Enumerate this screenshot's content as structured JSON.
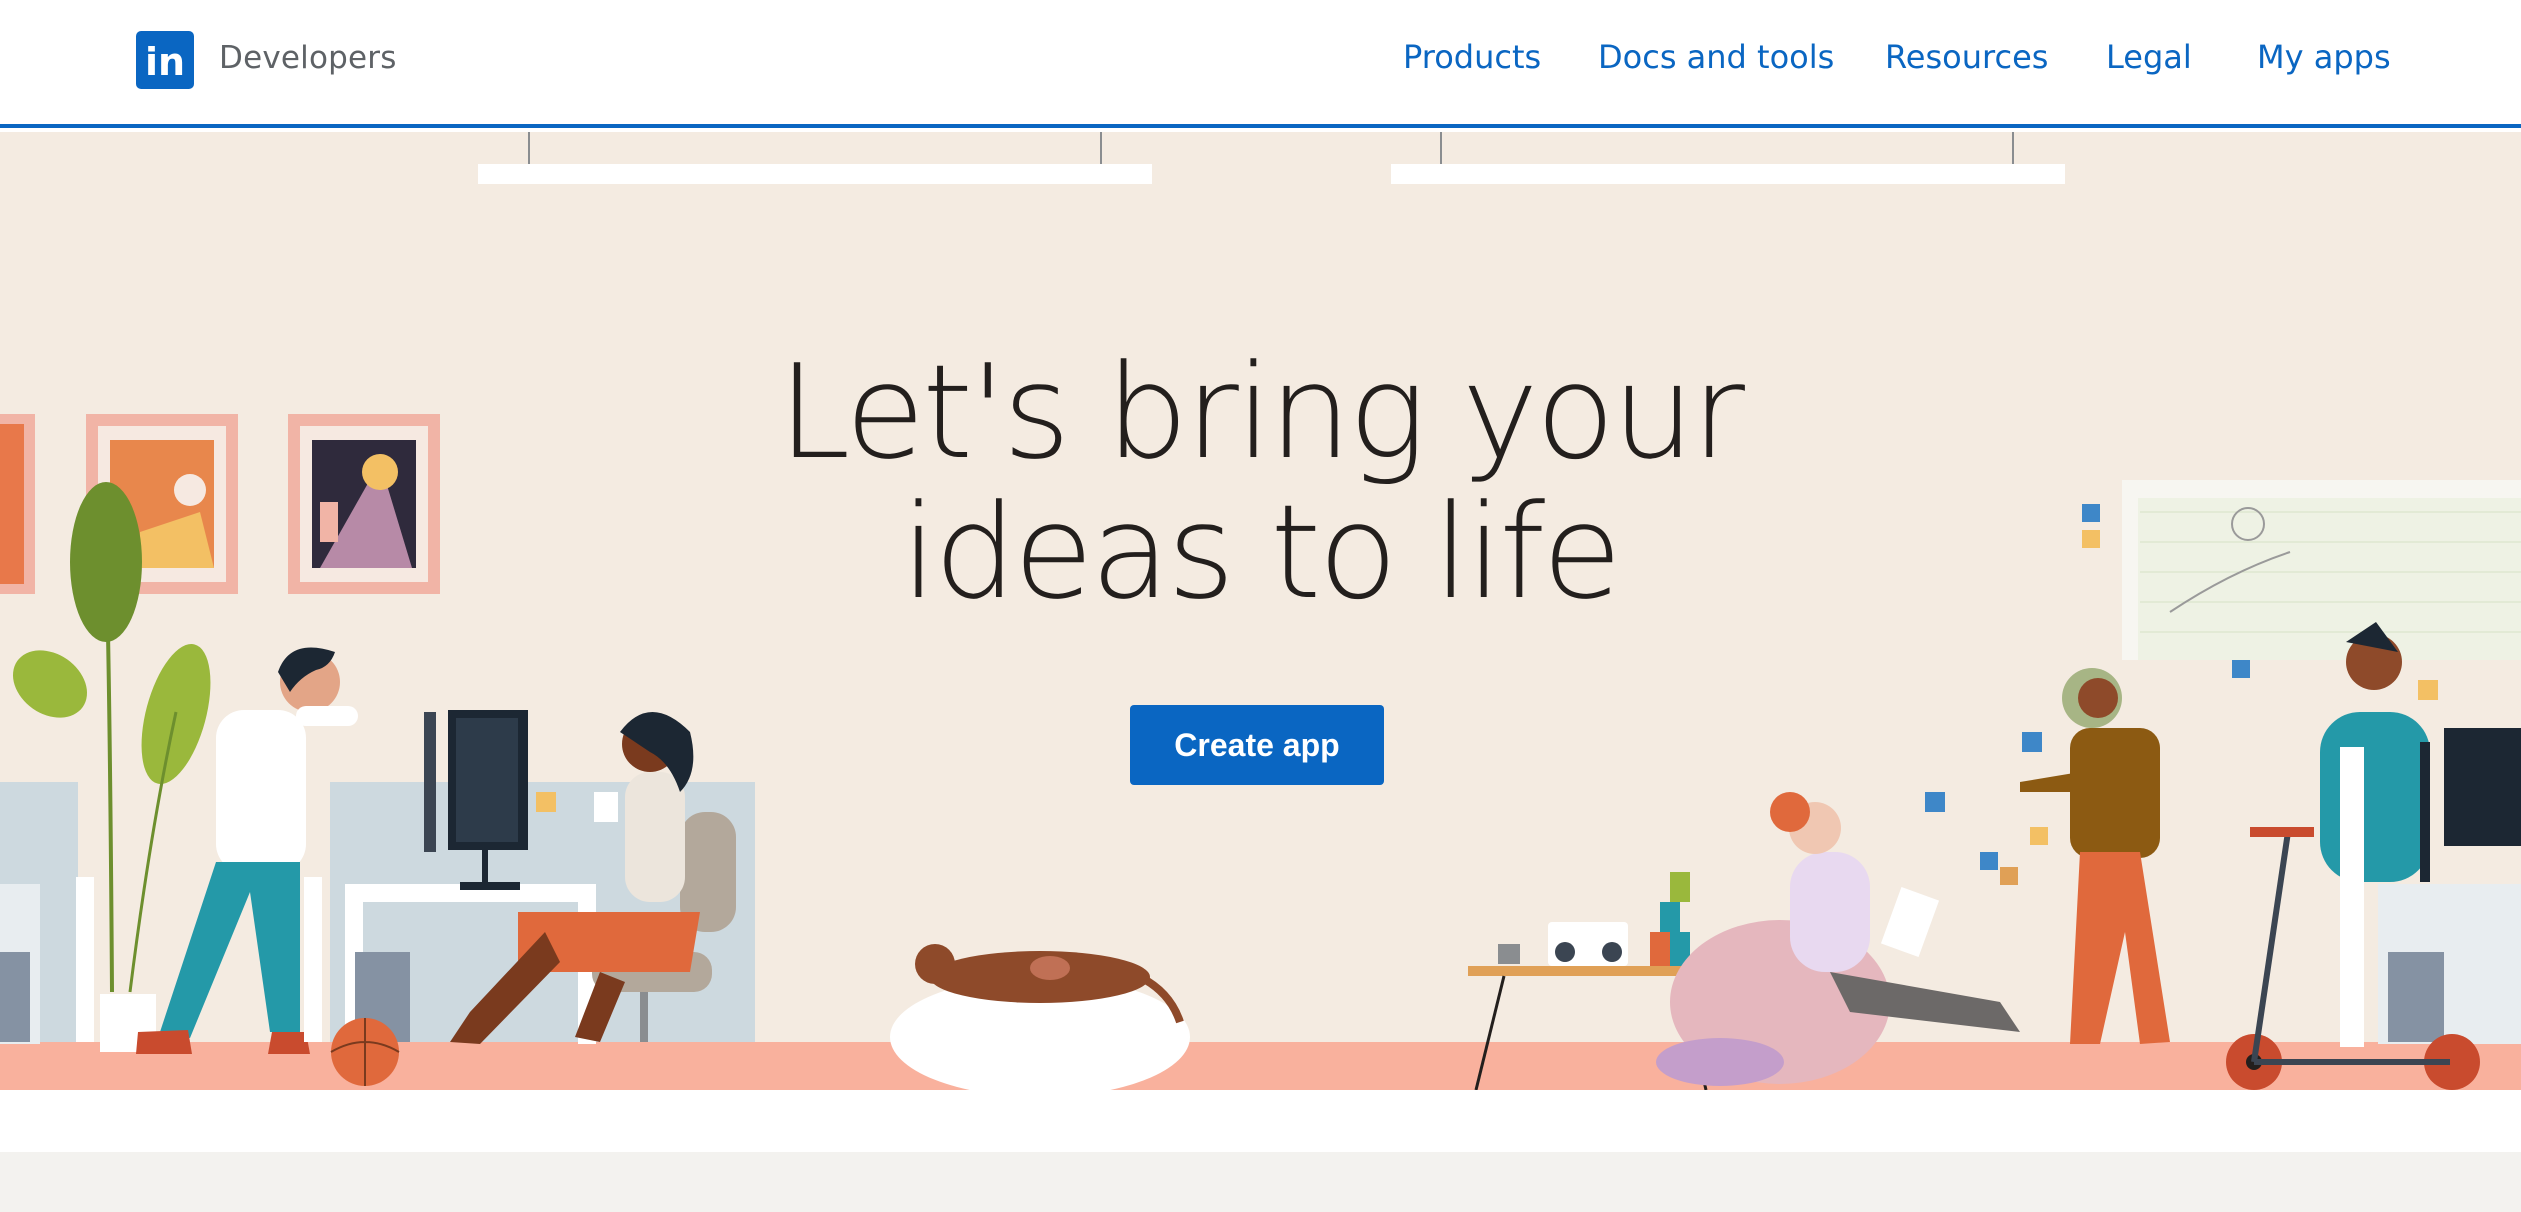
{
  "header": {
    "logo_text": "in",
    "brand": "Developers",
    "nav": [
      {
        "label": "Products",
        "name": "nav-products"
      },
      {
        "label": "Docs and tools",
        "name": "nav-docs-and-tools"
      },
      {
        "label": "Resources",
        "name": "nav-resources"
      },
      {
        "label": "Legal",
        "name": "nav-legal"
      },
      {
        "label": "My apps",
        "name": "nav-my-apps"
      }
    ]
  },
  "hero": {
    "title_line1": "Let's bring your",
    "title_line2": "ideas to life",
    "cta_label": "Create app"
  },
  "colors": {
    "brand_blue": "#0a66c2",
    "hero_background": "#f4ebe1",
    "title_text": "#231f1d",
    "footer_band": "#f3f2ef"
  },
  "icons": {
    "logo": "linkedin-icon"
  }
}
